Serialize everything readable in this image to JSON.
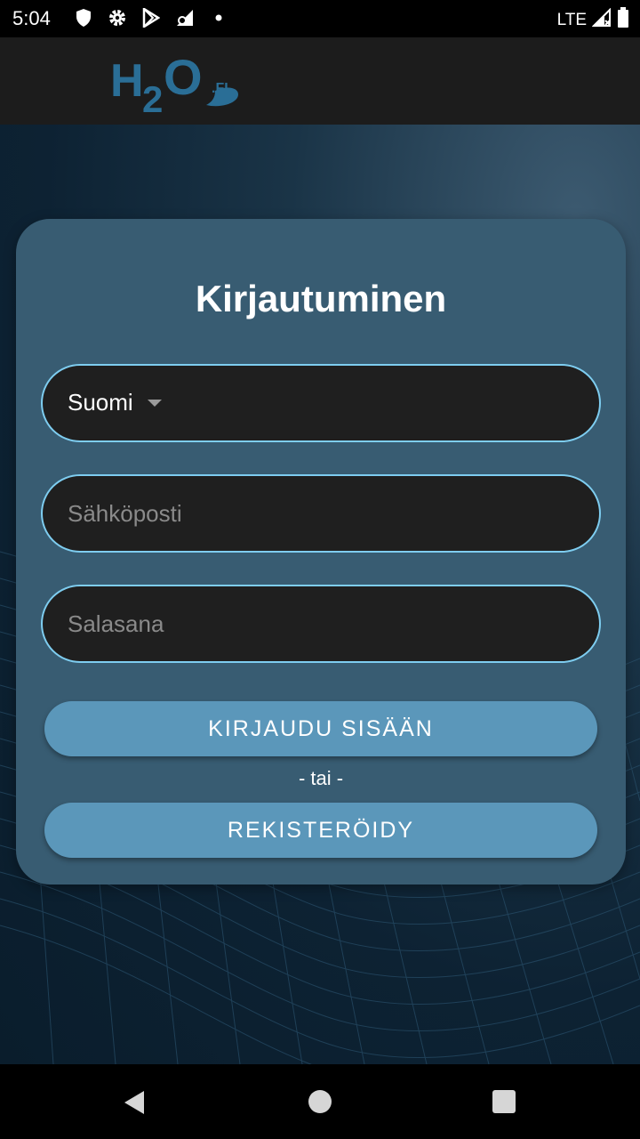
{
  "status_bar": {
    "time": "5:04",
    "network": "LTE",
    "icons": [
      "shield-icon",
      "gear-icon",
      "play-store-icon",
      "wifi-sync-icon",
      "dot-icon",
      "signal-icon",
      "battery-icon"
    ]
  },
  "header": {
    "logo_text": "H2O",
    "logo_suffix": ".FI"
  },
  "login": {
    "title": "Kirjautuminen",
    "language": {
      "selected": "Suomi"
    },
    "email": {
      "placeholder": "Sähköposti"
    },
    "password": {
      "placeholder": "Salasana"
    },
    "login_button": "KIRJAUDU SISÄÄN",
    "or_text": "- tai -",
    "register_button": "REKISTERÖIDY"
  },
  "colors": {
    "accent": "#5b97ba",
    "card": "#385c72",
    "field_border": "#7ecdf0",
    "logo": "#2a6e96"
  },
  "nav_bar": {
    "icons": [
      "back-icon",
      "home-icon",
      "recents-icon"
    ]
  }
}
